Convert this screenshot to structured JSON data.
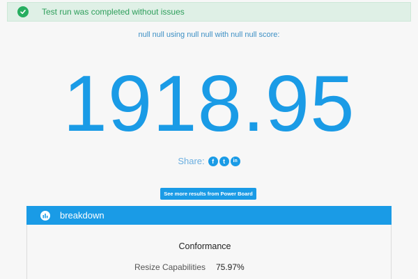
{
  "alert": {
    "message": "Test run was completed without issues",
    "color": "#27ae60"
  },
  "result": {
    "subtitle": "null null using null null with null null score:",
    "score": "1918.95"
  },
  "share": {
    "label": "Share:",
    "facebook_glyph": "f",
    "twitter_glyph": "t",
    "linkedin_glyph": "in"
  },
  "more_results_button": {
    "label": "See more results from Power Board"
  },
  "breakdown": {
    "title": "breakdown",
    "section": "Conformance",
    "metrics": [
      {
        "label": "Resize Capabilities",
        "value": "75.97%"
      }
    ]
  },
  "colors": {
    "accent": "#1a9be6",
    "success_bg": "#dff0e6",
    "success_text": "#2e9e5b"
  }
}
